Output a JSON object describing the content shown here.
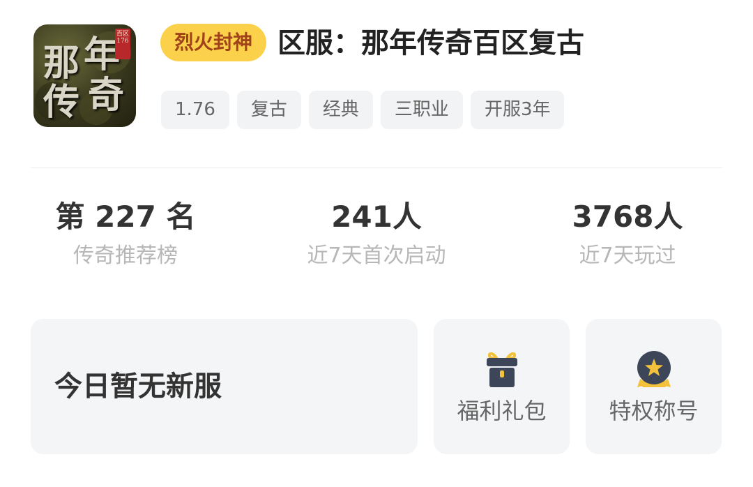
{
  "game": {
    "icon_alt": "那年传奇",
    "icon_chars": [
      "那",
      "年",
      "传",
      "奇"
    ],
    "icon_seal": "百区 176",
    "tag": "烈火封神",
    "title": "区服：那年传奇百区复古"
  },
  "chips": [
    "1.76",
    "复古",
    "经典",
    "三职业",
    "开服3年"
  ],
  "stats": {
    "rank": {
      "value": "第 227 名",
      "label": "传奇推荐榜"
    },
    "first_launch": {
      "value": "241人",
      "label": "近7天首次启动"
    },
    "played": {
      "value": "3768人",
      "label": "近7天玩过"
    }
  },
  "cards": {
    "new_server": {
      "label": "今日暂无新服"
    },
    "gift": {
      "label": "福利礼包",
      "icon": "gift-icon"
    },
    "title": {
      "label": "特权称号",
      "icon": "medal-icon"
    }
  },
  "colors": {
    "tag_bg": "#fbd04a",
    "tag_text": "#a0431b",
    "card_bg": "#f4f5f7",
    "icon_dark": "#3d4658",
    "accent_gold": "#f3c23a"
  }
}
